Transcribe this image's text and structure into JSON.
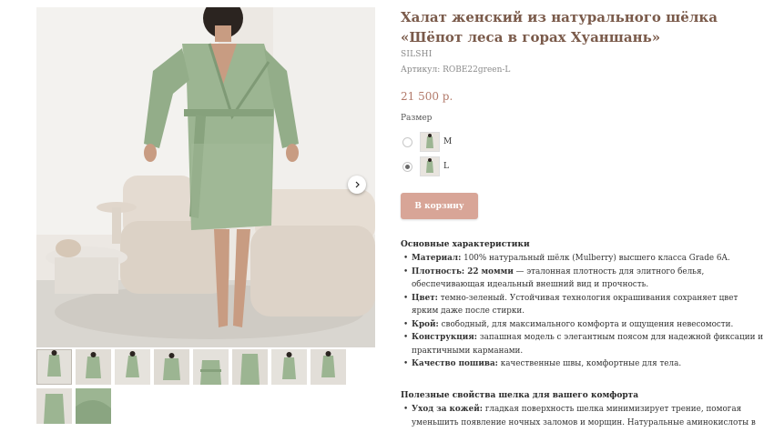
{
  "product": {
    "title": "Халат женский из натурального шёлка «Шёпот леса в горах Хуаншань»",
    "brand": "SILSHI",
    "sku": "Артикул: ROBE22green-L",
    "price": "21 500 р."
  },
  "size": {
    "label": "Размер",
    "options": [
      {
        "label": "M",
        "selected": false
      },
      {
        "label": "L",
        "selected": true
      }
    ]
  },
  "cart_button": "В корзину",
  "gallery": {
    "next_icon": "chevron-right-icon",
    "thumbnail_count": 10
  },
  "main_specs": {
    "title": "Основные характеристики",
    "items": [
      {
        "term": "Материал:",
        "text": "100% натуральный шёлк (Mulberry) высшего класса Grade 6A."
      },
      {
        "term": "Плотность: 22 момми",
        "text": "— эталонная плотность для элитного белья, обеспечивающая идеальный внешний вид и прочность."
      },
      {
        "term": "Цвет:",
        "text": "темно-зеленый. Устойчивая технология окрашивания сохраняет цвет ярким даже после стирки."
      },
      {
        "term": "Крой:",
        "text": "свободный, для максимального комфорта и ощущения невесомости."
      },
      {
        "term": "Конструкция:",
        "text": "запашная модель с элегантным поясом для надежной фиксации и практичными карманами."
      },
      {
        "term": "Качество пошива:",
        "text": "качественные швы, комфортные для тела."
      }
    ]
  },
  "benefits": {
    "title": "Полезные свойства шелка для вашего комфорта",
    "items": [
      {
        "term": "Уход за кожей:",
        "text": "гладкая поверхность шелка минимизирует трение, помогая уменьшить появление ночных заломов и морщин. Натуральные аминокислоты в"
      }
    ]
  },
  "colors": {
    "robe": "#9cb592",
    "accent": "#d8a597",
    "title": "#7a5a4a",
    "price": "#b27a6a"
  }
}
